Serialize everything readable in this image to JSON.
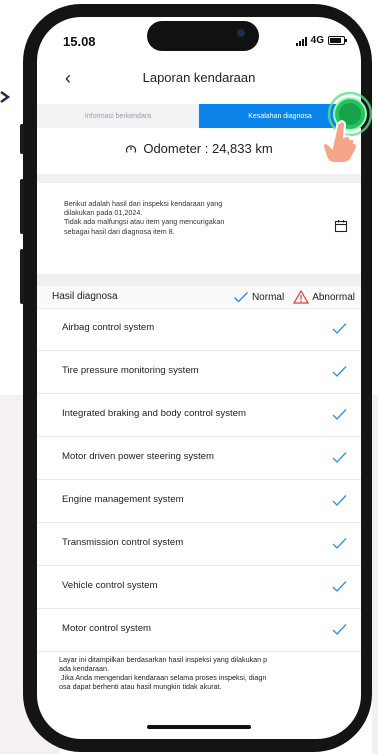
{
  "status_bar": {
    "time": "15.08",
    "network": "4G"
  },
  "header": {
    "title": "Laporan kendaraan",
    "back_icon": "chevron-left-icon"
  },
  "tabs": [
    {
      "label": "Informasi berkendara",
      "active": false
    },
    {
      "label": "Kesalahan diagnosa",
      "active": true
    }
  ],
  "odometer": {
    "text": "Odometer : 24,833 km",
    "icon": "speedometer-icon"
  },
  "report": {
    "lines": [
      "Berikut adalah hasil dari inspeksi kendaraan yang",
      "dilakukan pada 01,2024.",
      "Tidak ada malfungsi atau item yang mencurigakan",
      "sebagai hasil dari diagnosa item 8."
    ],
    "icon": "calendar-icon"
  },
  "diagnosis": {
    "title": "Hasil diagnosa",
    "legend_normal": "Normal",
    "legend_abnormal": "Abnormal",
    "items": [
      {
        "label": "Airbag control system",
        "status": "normal"
      },
      {
        "label": "Tire pressure monitoring system",
        "status": "normal"
      },
      {
        "label": "Integrated braking and body control system",
        "status": "normal"
      },
      {
        "label": "Motor driven power steering system",
        "status": "normal"
      },
      {
        "label": "Engine management system",
        "status": "normal"
      },
      {
        "label": "Transmission control system",
        "status": "normal"
      },
      {
        "label": "Vehicle control system",
        "status": "normal"
      },
      {
        "label": "Motor control system",
        "status": "normal"
      }
    ]
  },
  "footer": {
    "lines": [
      "Layar ini ditampilkan berdasarkan hasil inspeksi yang dilakukan p",
      "ada kendaraan.",
      " Jika Anda mengendari kendaraan selama proses inspeksi, diagn",
      "osa dapat berhenti atau hasil mungkin tidak akurat."
    ]
  },
  "colors": {
    "accent": "#0a84e8",
    "check": "#2a8ff0",
    "abnormal": "#e53935",
    "touch": "#22c55e",
    "hand": "#f4a58a"
  }
}
